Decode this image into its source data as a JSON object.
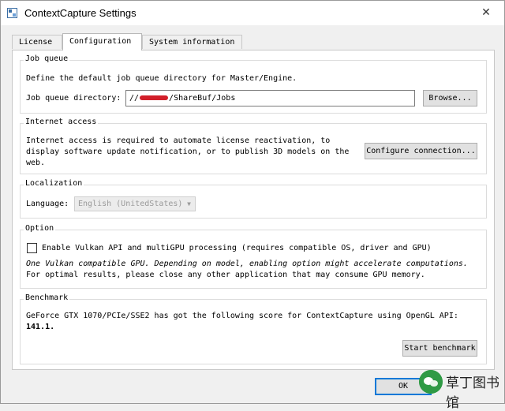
{
  "window": {
    "title": "ContextCapture Settings",
    "close_symbol": "✕"
  },
  "tabs": [
    {
      "label": "License",
      "active": false
    },
    {
      "label": "Configuration",
      "active": true
    },
    {
      "label": "System information",
      "active": false
    }
  ],
  "job_queue": {
    "title": "Job queue",
    "description": "Define the default job queue directory for Master/Engine.",
    "label": "Job queue directory:",
    "value_prefix": "//",
    "value_suffix": "/ShareBuf/Jobs",
    "browse_label": "Browse..."
  },
  "internet_access": {
    "title": "Internet access",
    "lines": [
      "Internet access is required to automate license reactivation, to",
      "display software update notification, or to publish 3D models on the",
      "web."
    ],
    "configure_label": "Configure connection..."
  },
  "localization": {
    "title": "Localization",
    "language_label": "Language:",
    "language_value": "English (UnitedStates)"
  },
  "option": {
    "title": "Option",
    "vulkan_label": "Enable Vulkan API and multiGPU processing (requires compatible OS, driver and GPU)",
    "vulkan_checked": false,
    "note_italic": "One Vulkan compatible GPU. Depending on model, enabling option might accelerate computations.",
    "note": "For optimal results, please close any other application that may consume GPU memory."
  },
  "benchmark": {
    "title": "Benchmark",
    "description": "GeForce GTX 1070/PCIe/SSE2 has got the following score for ContextCapture using OpenGL API:",
    "score": "141.1.",
    "start_label": "Start benchmark"
  },
  "footer": {
    "ok_label": "OK"
  },
  "watermark": {
    "text": "草丁图书馆"
  },
  "colors": {
    "accent": "#0078d7",
    "redaction": "#d21f2a",
    "watermark_logo": "#2f9a45"
  }
}
